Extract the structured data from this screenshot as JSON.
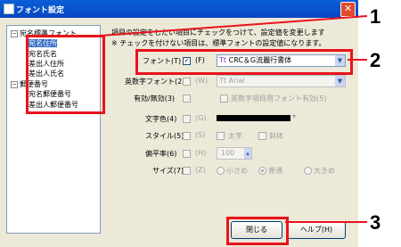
{
  "title": "フォント設定",
  "tree": {
    "root1": "宛名標準フォント",
    "items1": [
      "宛名住所",
      "宛名氏名",
      "差出人住所",
      "差出人氏名"
    ],
    "root2": "郵便番号",
    "items2": [
      "宛名郵便番号",
      "差出人郵便番号"
    ]
  },
  "info1": "項目の設定をしたい項目にチェックをつけて、設定値を変更します",
  "info2": "※ チェックを付けない項目は、標準フォントの設定値になります。",
  "rows": {
    "font": {
      "label": "フォント(T)",
      "mnemonic": "(F)",
      "value": "CRC＆G流麗行書体",
      "icon": "Tt"
    },
    "alnum_font": {
      "label": "英数字フォント(2)",
      "mnemonic": "(W)",
      "value": "Arial"
    },
    "valid": {
      "label": "有効/無効(3)",
      "option": "英数字項目用フォント有効(5)"
    },
    "color": {
      "label": "文字色(4)",
      "mnemonic": "(G)"
    },
    "style": {
      "label": "スタイル(5)",
      "mnemonic": "(S)",
      "opt1": "太字",
      "opt2": "斜体"
    },
    "flatness": {
      "label": "偏平率(6)",
      "mnemonic": "(H)",
      "value": "100"
    },
    "size": {
      "label": "サイズ(7)",
      "mnemonic": "(Z)",
      "opt1": "小さめ",
      "opt2": "普通",
      "opt3": "大きめ"
    }
  },
  "buttons": {
    "close": "閉じる",
    "help": "ヘルプ(H)"
  },
  "callouts": [
    "1",
    "2",
    "3"
  ],
  "colors": {
    "accent": "#e8131b",
    "titlebar": "#0a5fd8",
    "selection": "#316ac5"
  }
}
